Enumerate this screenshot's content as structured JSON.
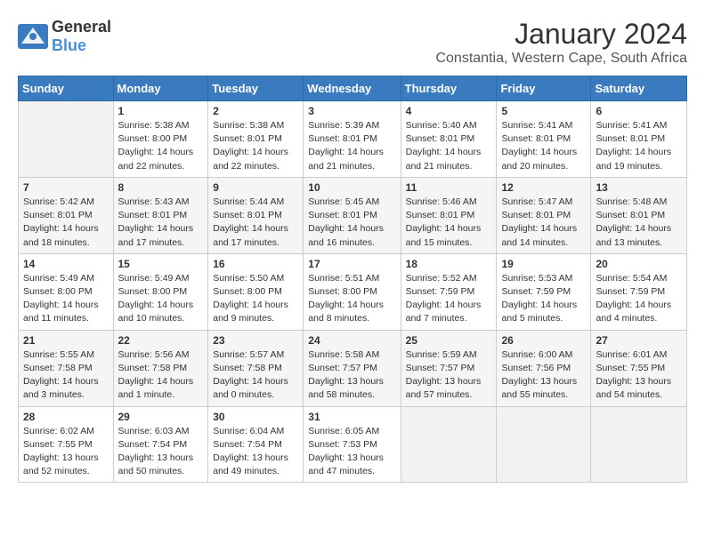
{
  "logo": {
    "general": "General",
    "blue": "Blue"
  },
  "title": "January 2024",
  "subtitle": "Constantia, Western Cape, South Africa",
  "days_of_week": [
    "Sunday",
    "Monday",
    "Tuesday",
    "Wednesday",
    "Thursday",
    "Friday",
    "Saturday"
  ],
  "weeks": [
    [
      {
        "day": "",
        "info": ""
      },
      {
        "day": "1",
        "info": "Sunrise: 5:38 AM\nSunset: 8:00 PM\nDaylight: 14 hours\nand 22 minutes."
      },
      {
        "day": "2",
        "info": "Sunrise: 5:38 AM\nSunset: 8:01 PM\nDaylight: 14 hours\nand 22 minutes."
      },
      {
        "day": "3",
        "info": "Sunrise: 5:39 AM\nSunset: 8:01 PM\nDaylight: 14 hours\nand 21 minutes."
      },
      {
        "day": "4",
        "info": "Sunrise: 5:40 AM\nSunset: 8:01 PM\nDaylight: 14 hours\nand 21 minutes."
      },
      {
        "day": "5",
        "info": "Sunrise: 5:41 AM\nSunset: 8:01 PM\nDaylight: 14 hours\nand 20 minutes."
      },
      {
        "day": "6",
        "info": "Sunrise: 5:41 AM\nSunset: 8:01 PM\nDaylight: 14 hours\nand 19 minutes."
      }
    ],
    [
      {
        "day": "7",
        "info": "Sunrise: 5:42 AM\nSunset: 8:01 PM\nDaylight: 14 hours\nand 18 minutes."
      },
      {
        "day": "8",
        "info": "Sunrise: 5:43 AM\nSunset: 8:01 PM\nDaylight: 14 hours\nand 17 minutes."
      },
      {
        "day": "9",
        "info": "Sunrise: 5:44 AM\nSunset: 8:01 PM\nDaylight: 14 hours\nand 17 minutes."
      },
      {
        "day": "10",
        "info": "Sunrise: 5:45 AM\nSunset: 8:01 PM\nDaylight: 14 hours\nand 16 minutes."
      },
      {
        "day": "11",
        "info": "Sunrise: 5:46 AM\nSunset: 8:01 PM\nDaylight: 14 hours\nand 15 minutes."
      },
      {
        "day": "12",
        "info": "Sunrise: 5:47 AM\nSunset: 8:01 PM\nDaylight: 14 hours\nand 14 minutes."
      },
      {
        "day": "13",
        "info": "Sunrise: 5:48 AM\nSunset: 8:01 PM\nDaylight: 14 hours\nand 13 minutes."
      }
    ],
    [
      {
        "day": "14",
        "info": "Sunrise: 5:49 AM\nSunset: 8:00 PM\nDaylight: 14 hours\nand 11 minutes."
      },
      {
        "day": "15",
        "info": "Sunrise: 5:49 AM\nSunset: 8:00 PM\nDaylight: 14 hours\nand 10 minutes."
      },
      {
        "day": "16",
        "info": "Sunrise: 5:50 AM\nSunset: 8:00 PM\nDaylight: 14 hours\nand 9 minutes."
      },
      {
        "day": "17",
        "info": "Sunrise: 5:51 AM\nSunset: 8:00 PM\nDaylight: 14 hours\nand 8 minutes."
      },
      {
        "day": "18",
        "info": "Sunrise: 5:52 AM\nSunset: 7:59 PM\nDaylight: 14 hours\nand 7 minutes."
      },
      {
        "day": "19",
        "info": "Sunrise: 5:53 AM\nSunset: 7:59 PM\nDaylight: 14 hours\nand 5 minutes."
      },
      {
        "day": "20",
        "info": "Sunrise: 5:54 AM\nSunset: 7:59 PM\nDaylight: 14 hours\nand 4 minutes."
      }
    ],
    [
      {
        "day": "21",
        "info": "Sunrise: 5:55 AM\nSunset: 7:58 PM\nDaylight: 14 hours\nand 3 minutes."
      },
      {
        "day": "22",
        "info": "Sunrise: 5:56 AM\nSunset: 7:58 PM\nDaylight: 14 hours\nand 1 minute."
      },
      {
        "day": "23",
        "info": "Sunrise: 5:57 AM\nSunset: 7:58 PM\nDaylight: 14 hours\nand 0 minutes."
      },
      {
        "day": "24",
        "info": "Sunrise: 5:58 AM\nSunset: 7:57 PM\nDaylight: 13 hours\nand 58 minutes."
      },
      {
        "day": "25",
        "info": "Sunrise: 5:59 AM\nSunset: 7:57 PM\nDaylight: 13 hours\nand 57 minutes."
      },
      {
        "day": "26",
        "info": "Sunrise: 6:00 AM\nSunset: 7:56 PM\nDaylight: 13 hours\nand 55 minutes."
      },
      {
        "day": "27",
        "info": "Sunrise: 6:01 AM\nSunset: 7:55 PM\nDaylight: 13 hours\nand 54 minutes."
      }
    ],
    [
      {
        "day": "28",
        "info": "Sunrise: 6:02 AM\nSunset: 7:55 PM\nDaylight: 13 hours\nand 52 minutes."
      },
      {
        "day": "29",
        "info": "Sunrise: 6:03 AM\nSunset: 7:54 PM\nDaylight: 13 hours\nand 50 minutes."
      },
      {
        "day": "30",
        "info": "Sunrise: 6:04 AM\nSunset: 7:54 PM\nDaylight: 13 hours\nand 49 minutes."
      },
      {
        "day": "31",
        "info": "Sunrise: 6:05 AM\nSunset: 7:53 PM\nDaylight: 13 hours\nand 47 minutes."
      },
      {
        "day": "",
        "info": ""
      },
      {
        "day": "",
        "info": ""
      },
      {
        "day": "",
        "info": ""
      }
    ]
  ]
}
